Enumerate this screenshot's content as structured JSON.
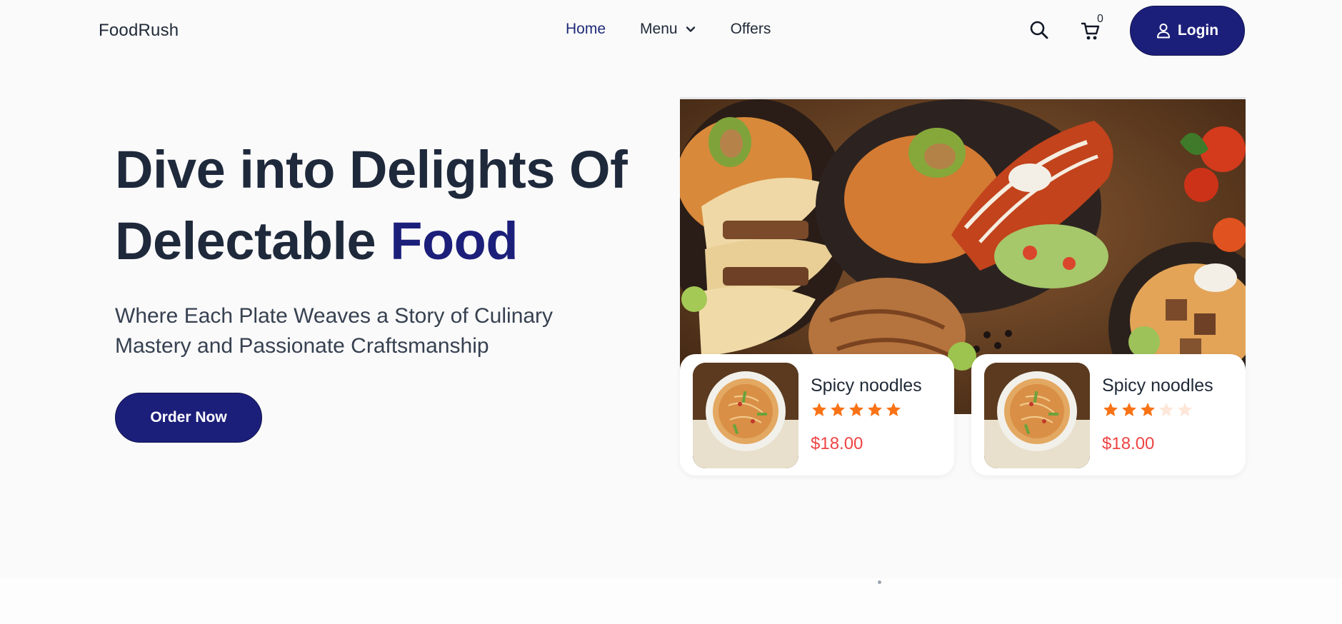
{
  "header": {
    "brand": "FoodRush",
    "nav": [
      {
        "label": "Home",
        "active": true
      },
      {
        "label": "Menu",
        "has_dropdown": true
      },
      {
        "label": "Offers"
      }
    ],
    "cart_count": "0",
    "login_label": "Login",
    "icons": {
      "search": "search-icon",
      "cart": "cart-icon",
      "user": "user-icon",
      "menu_dropdown": "chevron-down-icon"
    }
  },
  "hero": {
    "title_line1": "Dive into Delights Of",
    "title_line2_prefix": "Delectable",
    "title_line2_accent": "Food",
    "subtitle": "Where Each Plate Weaves a Story of Culinary Mastery and Passionate Craftsmanship",
    "cta_label": "Order Now"
  },
  "cards": [
    {
      "name": "Spicy noodles",
      "rating": 5,
      "max_rating": 5,
      "price": "$18.00"
    },
    {
      "name": "Spicy noodles",
      "rating": 3,
      "max_rating": 5,
      "price": "$18.00"
    }
  ],
  "colors": {
    "brand_navy": "#1c1f7a",
    "price_red": "#ef4444",
    "star_filled": "#f97316",
    "star_empty": "#fde7d9",
    "background": "#fafafa"
  }
}
